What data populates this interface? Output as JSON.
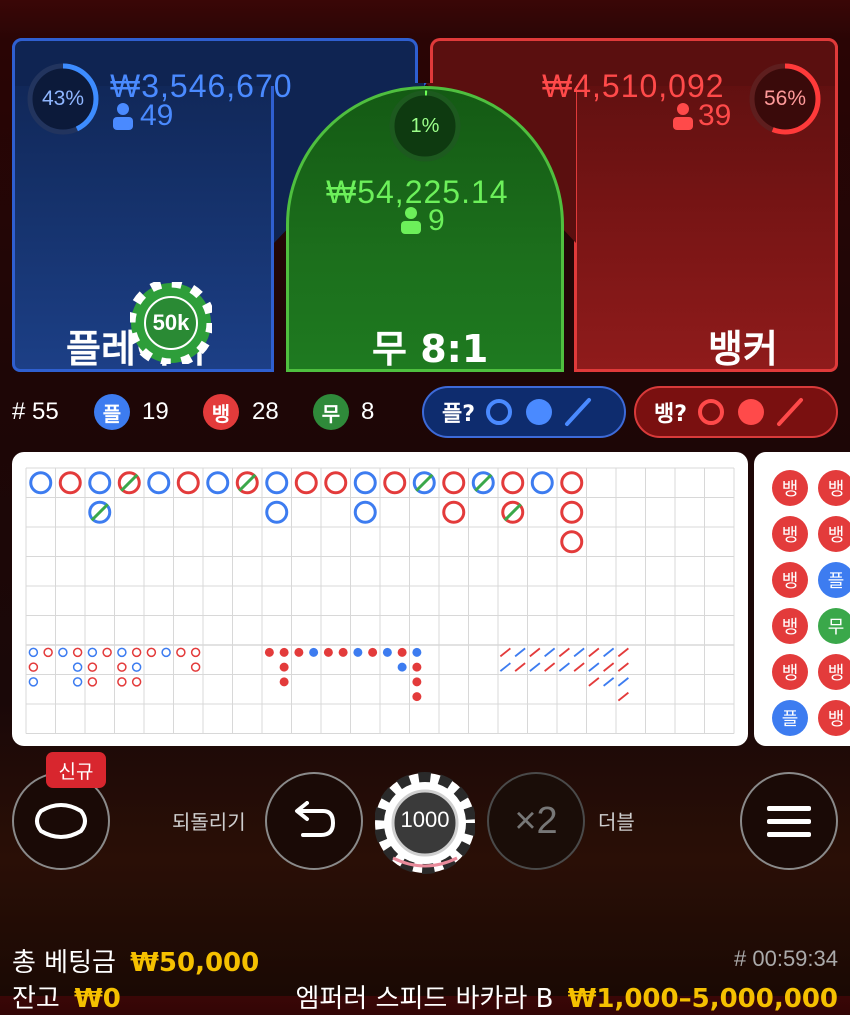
{
  "player": {
    "percent": "43%",
    "percent_value": 0.43,
    "amount": "₩3,546,670",
    "bettors": "49",
    "label": "플레이어",
    "color": "#3d7cf0"
  },
  "tie": {
    "percent": "1%",
    "percent_value": 0.01,
    "amount": "₩54,225.14",
    "bettors": "9",
    "label": "무 8:1",
    "color": "#5fe04a"
  },
  "banker": {
    "percent": "56%",
    "percent_value": 0.56,
    "amount": "₩4,510,092",
    "bettors": "39",
    "label": "뱅커",
    "color": "#ff4a4a"
  },
  "placed_chip": {
    "value": "50k"
  },
  "stats": {
    "round": "# 55",
    "player_letter": "플",
    "player_count": "19",
    "banker_letter": "뱅",
    "banker_count": "28",
    "tie_letter": "무",
    "tie_count": "8"
  },
  "predict": {
    "player_label": "플?",
    "banker_label": "뱅?"
  },
  "big_road": [
    [
      "P"
    ],
    [
      "B"
    ],
    [
      "P",
      "P/T"
    ],
    [
      "B/T"
    ],
    [
      "P"
    ],
    [
      "B"
    ],
    [
      "P"
    ],
    [
      "B/T"
    ],
    [
      "P",
      "P"
    ],
    [
      "B"
    ],
    [
      "B"
    ],
    [
      "P",
      "P"
    ],
    [
      "B"
    ],
    [
      "P/T"
    ],
    [
      "B",
      "B"
    ],
    [
      "P/T"
    ],
    [
      "B",
      "B/T"
    ],
    [
      "P"
    ],
    [
      "B",
      "B",
      "B"
    ]
  ],
  "bead_road": [
    "뱅",
    "뱅",
    "뱅",
    "뱅",
    "뱅",
    "플",
    "뱅",
    "뱅",
    "플",
    "무",
    "뱅",
    "뱅"
  ],
  "controls": {
    "new_badge": "신규",
    "undo_label": "되돌리기",
    "chip_value": "1000",
    "double_symbol": "×2",
    "double_label": "더블"
  },
  "footer": {
    "total_bet_label": "총 베팅금",
    "total_bet_value": "₩50,000",
    "balance_label": "잔고",
    "balance_value": "₩0",
    "timer": "# 00:59:34",
    "table_name": "엠퍼러 스피드 바카라 B",
    "limits": "₩1,000–5,000,000"
  },
  "colors": {
    "player_blue": "#3d7cf0",
    "banker_red": "#e33b3b",
    "tie_green": "#3aa84a",
    "gold": "#f5c000"
  }
}
